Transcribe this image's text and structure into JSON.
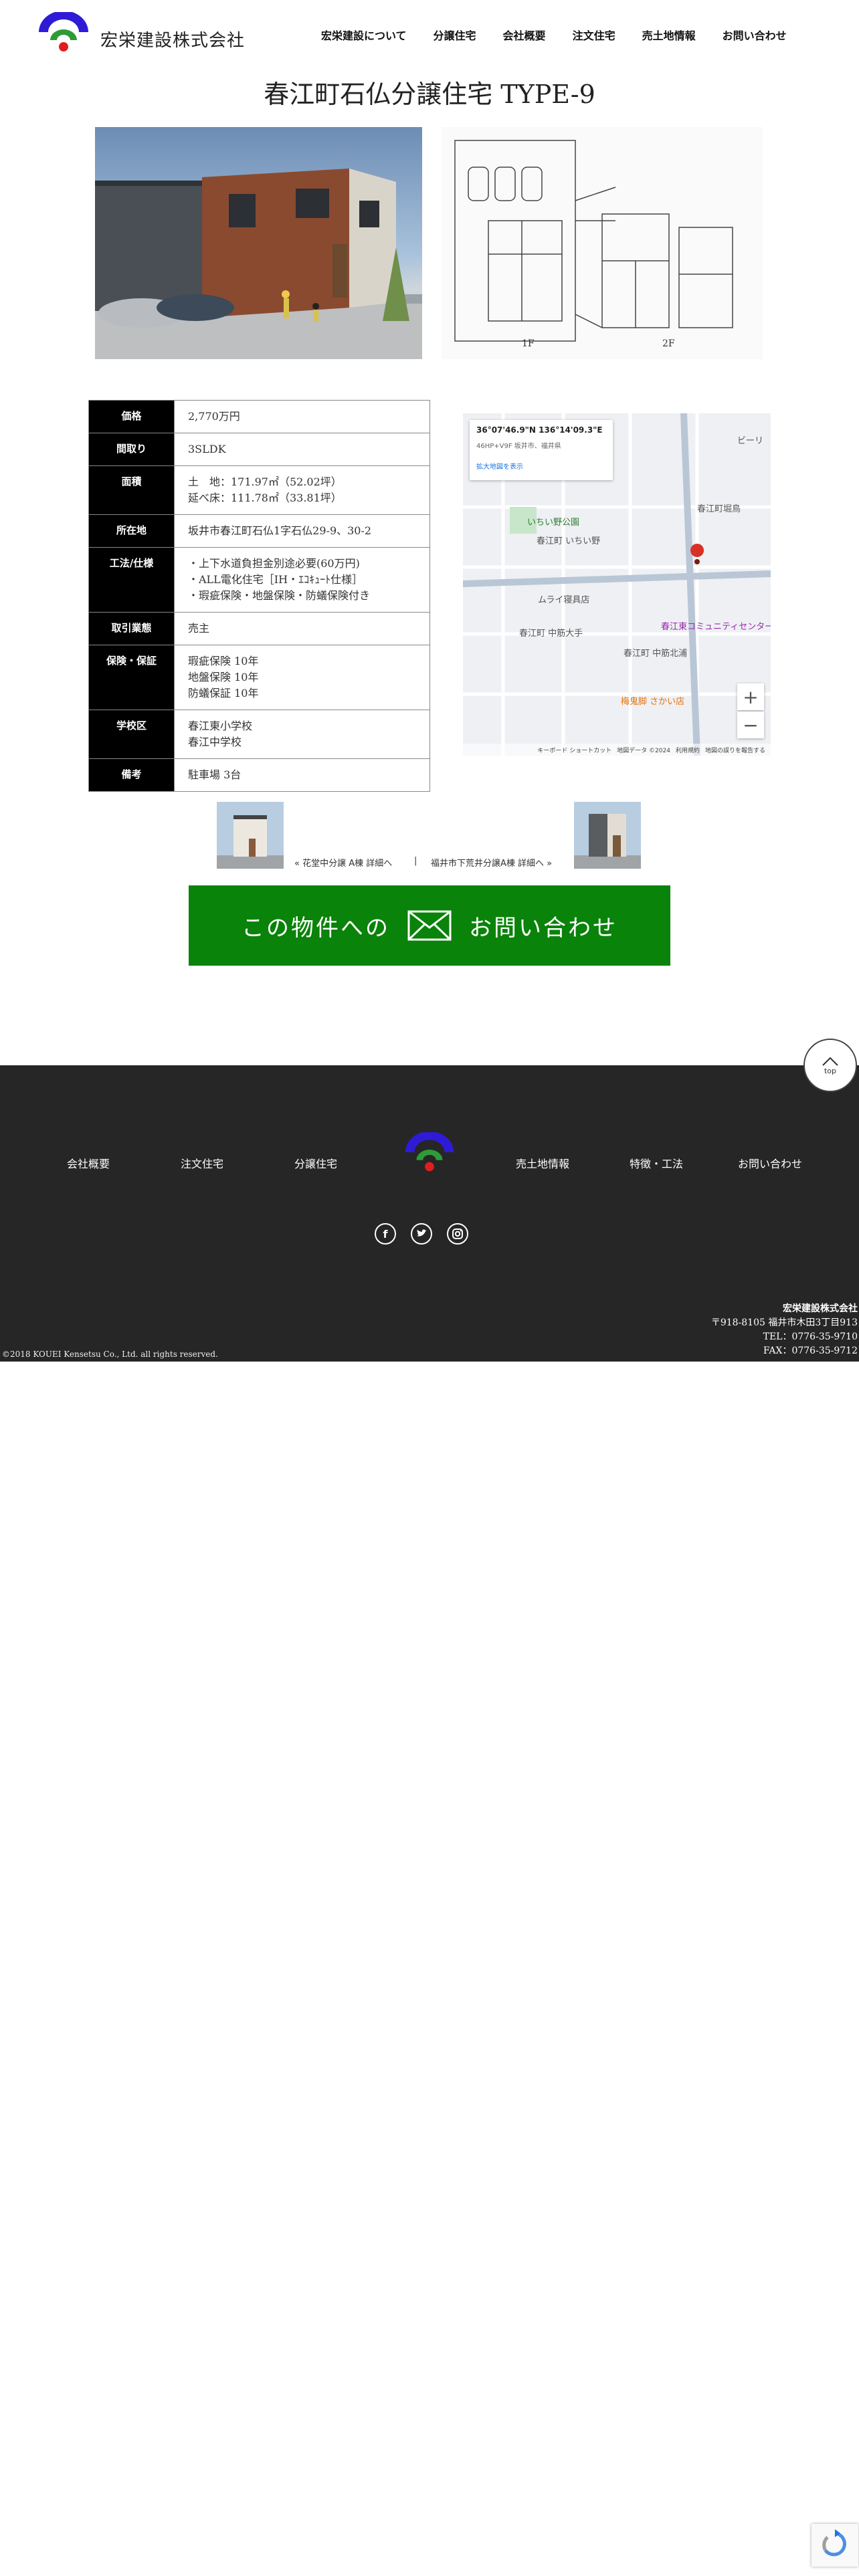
{
  "header": {
    "company_name": "宏栄建設株式会社",
    "nav": [
      "宏栄建設について",
      "分譲住宅",
      "会社概要",
      "注文住宅",
      "売土地情報",
      "お問い合わせ"
    ]
  },
  "page_title": "春江町石仏分譲住宅 TYPE-9",
  "floorplan": {
    "floor1_label": "1F",
    "floor2_label": "2F"
  },
  "spec": {
    "rows": [
      {
        "label": "価格",
        "lines": [
          "2,770万円"
        ]
      },
      {
        "label": "間取り",
        "lines": [
          "3SLDK"
        ]
      },
      {
        "label": "面積",
        "lines": [
          "土　地：171.97㎡（52.02坪）",
          "延べ床：111.78㎡（33.81坪）"
        ]
      },
      {
        "label": "所在地",
        "lines": [
          "坂井市春江町石仏1字石仏29-9、30-2"
        ]
      },
      {
        "label": "工法/仕様",
        "lines": [
          "・上下水道負担金別途必要(60万円)",
          "・ALL電化住宅［IH・ｴｺｷｭｰﾄ仕様］",
          "・瑕疵保険・地盤保険・防蟻保険付き"
        ]
      },
      {
        "label": "取引業態",
        "lines": [
          "売主"
        ]
      },
      {
        "label": "保険・保証",
        "lines": [
          "瑕疵保険 10年",
          "地盤保険 10年",
          "防蟻保証 10年"
        ]
      },
      {
        "label": "学校区",
        "lines": [
          "春江東小学校",
          "春江中学校"
        ]
      },
      {
        "label": "備考",
        "lines": [
          "駐車場 3台"
        ]
      }
    ]
  },
  "map": {
    "coords": "36°07'46.9\"N 136°14'09.3\"E",
    "address": "46HP+V9F 坂井市、福井県",
    "enlarge_link": "拡大地図を表示",
    "labels": [
      "いちい野公園",
      "春江町 いちい野",
      "ムライ寝具店",
      "春江町 中筋大手",
      "春江町 中筋北浦",
      "春江町堀鳥",
      "春江東コミュニティセンター",
      "梅鬼脚 さかい店",
      "ビーリ"
    ],
    "zoom_in": "+",
    "zoom_out": "−",
    "footer": [
      "キーボード ショートカット",
      "地図データ ©2024",
      "利用規約",
      "地図の誤りを報告する"
    ]
  },
  "related": {
    "prev_text": "« 花堂中分譲 A棟 詳細へ",
    "separator": "|",
    "next_text": "福井市下荒井分譲A棟 詳細へ »"
  },
  "contact_button": {
    "text_before": "この物件への",
    "text_after": "お問い合わせ"
  },
  "top_button": {
    "label": "top"
  },
  "footer": {
    "nav": [
      "会社概要",
      "注文住宅",
      "分譲住宅",
      "売土地情報",
      "特徴・工法",
      "お問い合わせ"
    ],
    "company_name": "宏栄建設株式会社",
    "address": "〒918-8105 福井市木田3丁目913",
    "tel": "TEL：0776-35-9710",
    "fax": "FAX：0776-35-9712",
    "copyright": "©2018 KOUEI Kensetsu Co., Ltd. all rights reserved."
  },
  "colors": {
    "logo_blue": "#2f1bd6",
    "logo_green": "#2e9a38",
    "logo_red": "#e01e1e",
    "contact_green": "#098309",
    "footer_bg": "#262626"
  }
}
